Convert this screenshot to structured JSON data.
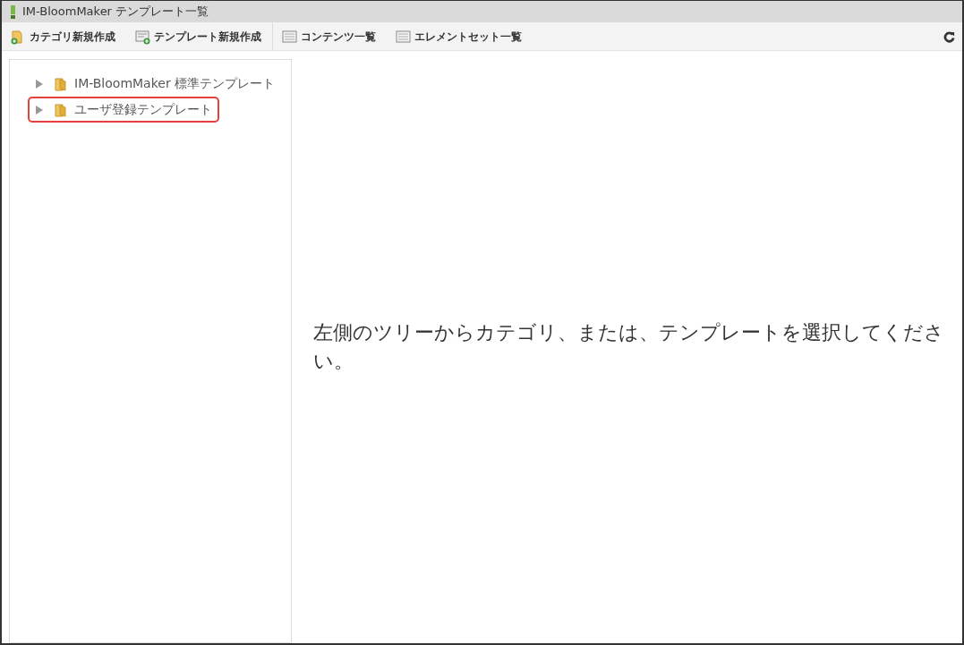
{
  "window": {
    "title": "IM-BloomMaker テンプレート一覧"
  },
  "toolbar": [
    {
      "kind": "folder-add",
      "label": "カテゴリ新規作成"
    },
    {
      "kind": "doc-add",
      "label": "テンプレート新規作成"
    },
    {
      "kind": "list",
      "label": "コンテンツ一覧"
    },
    {
      "kind": "list",
      "label": "エレメントセット一覧"
    }
  ],
  "tree": [
    {
      "label": "IM-BloomMaker 標準テンプレート",
      "expanded": false,
      "highlighted": false
    },
    {
      "label": "ユーザ登録テンプレート",
      "expanded": false,
      "highlighted": true
    }
  ],
  "message": "左側のツリーからカテゴリ、または、テンプレートを選択してください。"
}
